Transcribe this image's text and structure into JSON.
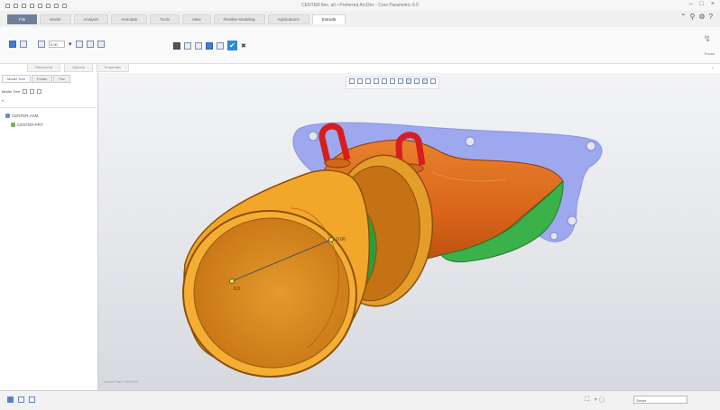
{
  "window": {
    "title": "CENTER flex. alt • Preferred ArcDev - Creo Parametric 5.0",
    "controls": [
      "–",
      "□",
      "×"
    ],
    "help": [
      "⌃",
      "⚲",
      "⚙",
      "?"
    ]
  },
  "ribbon": {
    "tabs": [
      {
        "label": "File",
        "file": true
      },
      {
        "label": "Model"
      },
      {
        "label": "Analysis"
      },
      {
        "label": "Annotate"
      },
      {
        "label": "Tools"
      },
      {
        "label": "View"
      },
      {
        "label": "Flexible Modeling"
      },
      {
        "label": "Applications"
      },
      {
        "label": "Extrude",
        "active": true
      }
    ],
    "depth_value": "0.00",
    "pause_label": "Pause",
    "subtabs": [
      "Placement",
      "Options",
      "Properties"
    ]
  },
  "left_pane": {
    "tabs": [
      "Model Tree",
      "Folder",
      "Fav"
    ],
    "tree_label": "Model Tree",
    "items": [
      {
        "label": "CENTER.ASM",
        "icon": "assembly-icon"
      },
      {
        "label": "CENTER.PRT",
        "icon": "part-icon"
      }
    ]
  },
  "viewport": {
    "annotation_dim": "0.00",
    "annotation_small": "0.0",
    "status_small": "Select Part: CENTER"
  },
  "status_bar": {
    "filter_value": "Smart"
  },
  "colors": {
    "flange": "#9ea8ef",
    "horn_outer": "#f2a72a",
    "horn_dark": "#c46a10",
    "duct_body": "#dc6a1d",
    "inner_green": "#3bb14a",
    "lifting_eye": "#d61e1e",
    "file_tab": "#6e7f99"
  }
}
